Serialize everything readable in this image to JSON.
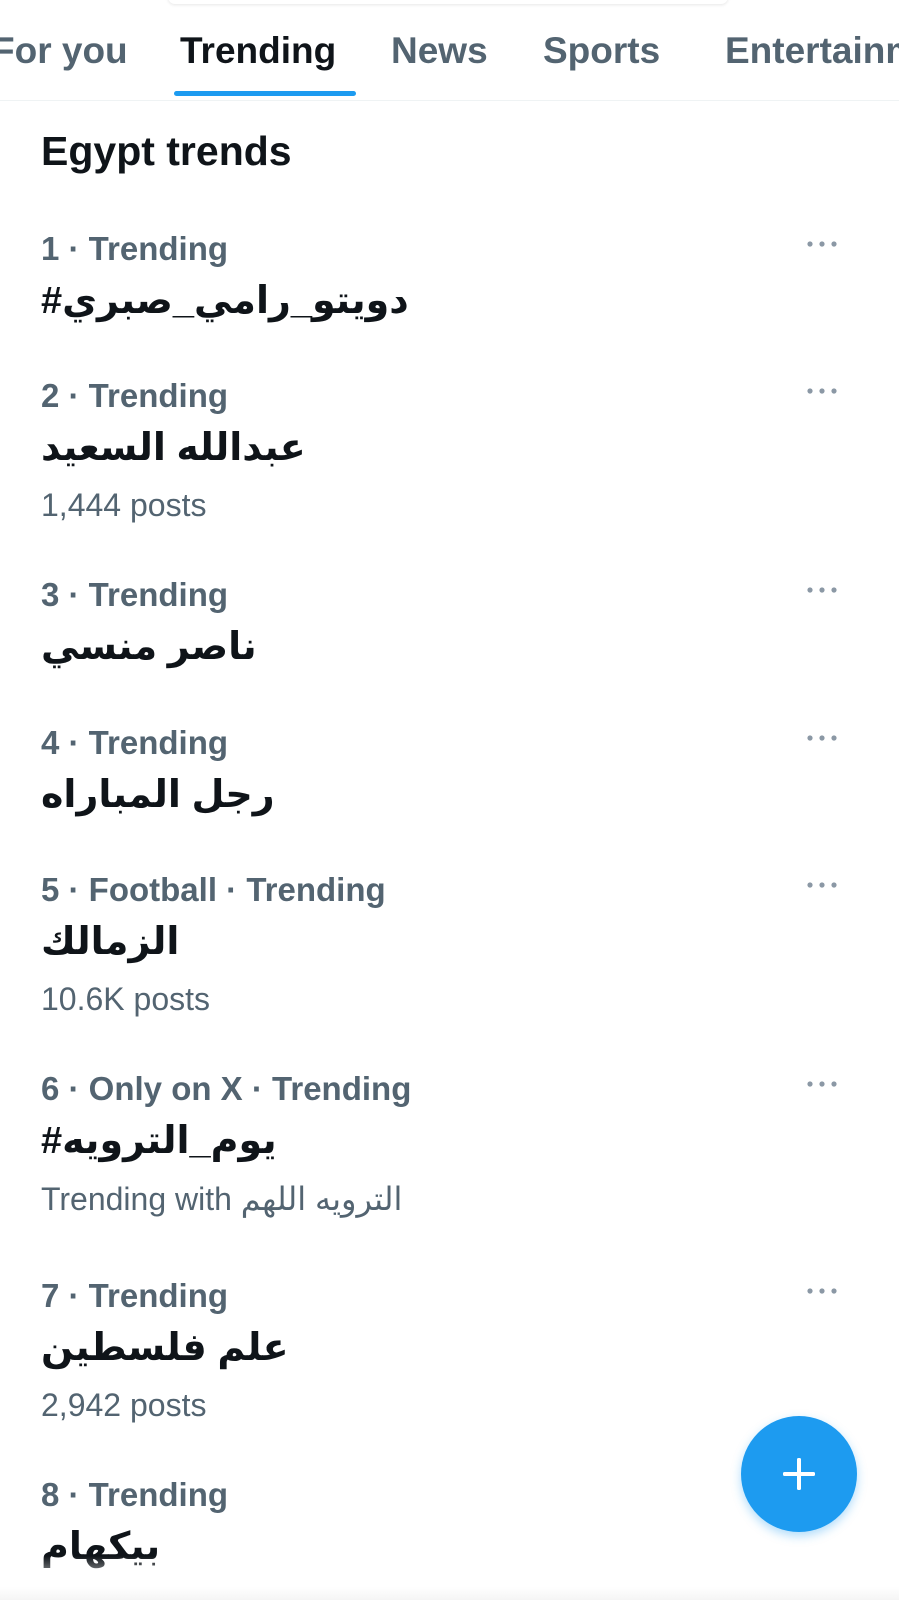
{
  "tabs": [
    {
      "label": "For you"
    },
    {
      "label": "Trending"
    },
    {
      "label": "News"
    },
    {
      "label": "Sports"
    },
    {
      "label": "Entertainment"
    }
  ],
  "active_tab": "Trending",
  "section_title": "Egypt trends",
  "trends": [
    {
      "meta": "1 · Trending",
      "name": "#دويتو_رامي_صبري",
      "posts": ""
    },
    {
      "meta": "2 · Trending",
      "name": "عبدالله السعيد",
      "posts": "1,444 posts"
    },
    {
      "meta": "3 · Trending",
      "name": "ناصر منسي",
      "posts": ""
    },
    {
      "meta": "4 · Trending",
      "name": "رجل المباراه",
      "posts": ""
    },
    {
      "meta": "5 · Football · Trending",
      "name": "الزمالك",
      "posts": "10.6K posts"
    },
    {
      "meta": "6 · Only on X · Trending",
      "name": "#يوم_الترويه",
      "posts": "Trending with الترويه اللهم"
    },
    {
      "meta": "7 · Trending",
      "name": "علم فلسطين",
      "posts": "2,942 posts"
    },
    {
      "meta": "8 · Trending",
      "name": "بيكهام",
      "posts": ""
    }
  ],
  "icons": {
    "more": "more-horizontal-icon",
    "compose": "plus-icon"
  },
  "colors": {
    "accent": "#1d9bf0",
    "text_primary": "#0f1419",
    "text_secondary": "#536471"
  }
}
